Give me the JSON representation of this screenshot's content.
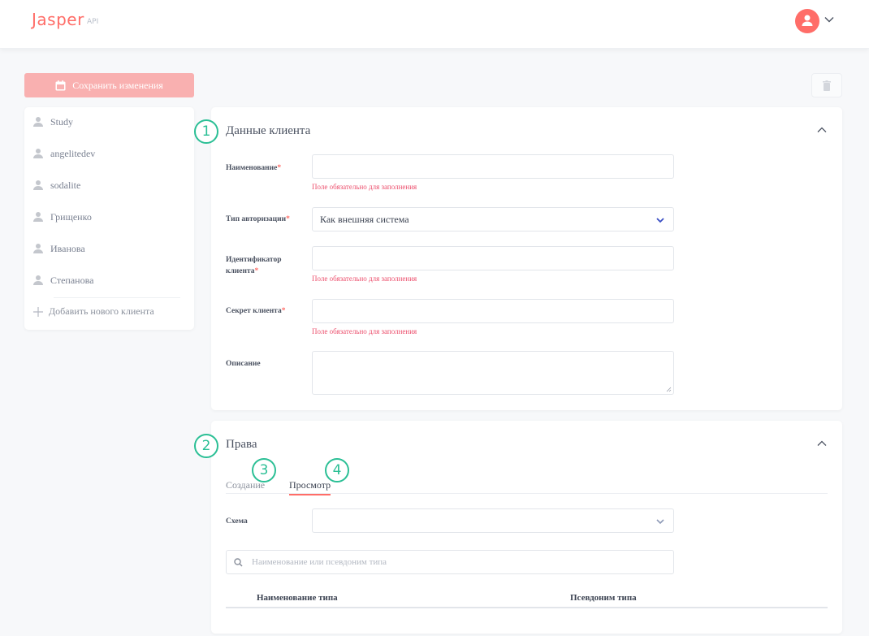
{
  "app": {
    "logo": "Jasper",
    "logo_sub": "API"
  },
  "header": {
    "avatar_icon": "user-icon",
    "menu_icon": "chevron-down-icon"
  },
  "toolbar": {
    "save_label": "Сохранить изменения",
    "save_icon": "calendar-save-icon",
    "delete_icon": "trash-icon"
  },
  "clients": {
    "items": [
      {
        "label": "Study"
      },
      {
        "label": "angelitedev"
      },
      {
        "label": "sodalite"
      },
      {
        "label": "Грищенко"
      },
      {
        "label": "Иванова"
      },
      {
        "label": "Степанова"
      }
    ],
    "add_label": "Добавить нового клиента"
  },
  "client_data": {
    "badge": "1",
    "title": "Данные клиента",
    "fields": {
      "name": {
        "label": "Наименование",
        "required": "*",
        "value": "",
        "error": "Поле обязательно для заполнения"
      },
      "auth_type": {
        "label": "Тип авторизации",
        "required": "*",
        "value": "Как внешняя система"
      },
      "client_id": {
        "label": "Идентификатор клиента",
        "required": "*",
        "value": "",
        "error": "Поле обязательно для заполнения"
      },
      "secret": {
        "label": "Секрет клиента",
        "required": "*",
        "value": "",
        "error": "Поле обязательно для заполнения"
      },
      "description": {
        "label": "Описание",
        "value": ""
      }
    }
  },
  "rights": {
    "badge": "2",
    "title": "Права",
    "tabs": [
      {
        "label": "Создание",
        "badge": "3",
        "active": false
      },
      {
        "label": "Просмотр",
        "badge": "4",
        "active": true
      }
    ],
    "schema": {
      "label": "Схема",
      "value": ""
    },
    "search": {
      "placeholder": "Наименование или псевдоним типа"
    },
    "table": {
      "columns": [
        "Наименование типа",
        "Псевдоним типа"
      ],
      "rows": []
    }
  },
  "colors": {
    "brand": "#ff6d68",
    "badge": "#2bbf95",
    "error": "#ec4d6b",
    "save_button": "#f9b0b0"
  }
}
